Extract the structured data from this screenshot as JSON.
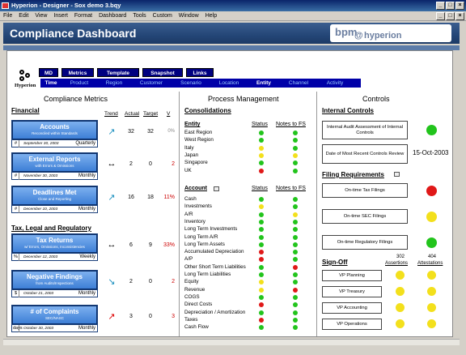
{
  "window": {
    "title": "Hyperion - Designer - Sox demo 3.bqy"
  },
  "menu": [
    "File",
    "Edit",
    "View",
    "Insert",
    "Format",
    "Dashboard",
    "Tools",
    "Custom",
    "Window",
    "Help"
  ],
  "header": {
    "title": "Compliance Dashboard",
    "brand_bpm": "bpm",
    "brand_at": "@",
    "brand_hyp": "hyperion"
  },
  "logo": {
    "text": "Hyperion"
  },
  "top_buttons": [
    "MD",
    "Metrics",
    "Template",
    "Snapshot",
    "Links"
  ],
  "tabs": [
    "Time",
    "Product",
    "Region",
    "Customer",
    "Scenario",
    "Location",
    "Entity",
    "Channel",
    "Activity"
  ],
  "active_tab": "Entity",
  "sections": {
    "left": "Compliance Metrics",
    "mid": "Process Management",
    "right": "Controls"
  },
  "left": {
    "financial": "Financial",
    "tax": "Tax, Legal and Regulatory",
    "cols": {
      "trend": "Trend",
      "actual": "Actual",
      "target": "Target",
      "v": "V"
    },
    "metrics": [
      {
        "name": "Accounts",
        "sub": "Reconciled within Standards",
        "sym": "#",
        "date": "September 30, 2003",
        "freq": "Quarterly",
        "trend": "↗",
        "actual": "32",
        "target": "32",
        "var": "0%",
        "trend_color": "#1a8fbf"
      },
      {
        "name": "External Reports",
        "sub": "with Errors & Omissions",
        "sym": "#",
        "date": "November 30, 2003",
        "freq": "Monthly",
        "trend": "↔",
        "actual": "2",
        "target": "0",
        "var": "2",
        "trend_color": "#000"
      },
      {
        "name": "Deadlines Met",
        "sub": "Close and Reporting",
        "sym": "#",
        "date": "December 10, 2003",
        "freq": "Monthly",
        "trend": "↗",
        "actual": "16",
        "target": "18",
        "var": "11%",
        "trend_color": "#1a8fbf"
      },
      {
        "name": "Tax Returns",
        "sub": "w/ Errors, Omissions, Inconsistencies",
        "sym": "%",
        "date": "December 12, 2003",
        "freq": "Weekly",
        "trend": "↔",
        "actual": "6",
        "target": "9",
        "var": "33%",
        "trend_color": "#000"
      },
      {
        "name": "Negative Findings",
        "sub": "from Audits/Inspections",
        "sym": "$",
        "date": "October 21, 2003",
        "freq": "Monthly",
        "trend": "↘",
        "actual": "2",
        "target": "0",
        "var": "2",
        "trend_color": "#1a8fbf"
      },
      {
        "name": "# of Complaints",
        "sub": "SEC/NASC",
        "sym": "days",
        "date": "October 30, 2003",
        "freq": "Monthly",
        "trend": "↗",
        "actual": "3",
        "target": "0",
        "var": "3",
        "trend_color": "#d00"
      }
    ]
  },
  "mid": {
    "consolidations": "Consolidations",
    "entity_head": "Entity",
    "status_head": "Status",
    "notes_head": "Notes to FS",
    "entities": [
      {
        "name": "East Region",
        "s": "g",
        "n": "g"
      },
      {
        "name": "West Region",
        "s": "g",
        "n": "g"
      },
      {
        "name": "Italy",
        "s": "y",
        "n": "g"
      },
      {
        "name": "Japan",
        "s": "y",
        "n": "y"
      },
      {
        "name": "Singapore",
        "s": "g",
        "n": "g"
      },
      {
        "name": "UK",
        "s": "r",
        "n": "g"
      }
    ],
    "account_head": "Account",
    "accounts": [
      {
        "name": "Cash",
        "s": "g",
        "n": "g"
      },
      {
        "name": "Investments",
        "s": "y",
        "n": "g"
      },
      {
        "name": "A/R",
        "s": "g",
        "n": "y"
      },
      {
        "name": "Inventory",
        "s": "g",
        "n": "g"
      },
      {
        "name": "Long Term Investments",
        "s": "g",
        "n": "g"
      },
      {
        "name": "Long Term A/R",
        "s": "g",
        "n": "g"
      },
      {
        "name": "Long Term Assets",
        "s": "g",
        "n": "g"
      },
      {
        "name": "Accumulated Depreciation",
        "s": "r",
        "n": "g"
      },
      {
        "name": "A/P",
        "s": "r",
        "n": "g"
      },
      {
        "name": "Other Short Term Liabilities",
        "s": "g",
        "n": "r"
      },
      {
        "name": "Long Term Liabilities",
        "s": "g",
        "n": "g"
      },
      {
        "name": "Equity",
        "s": "y",
        "n": "g"
      },
      {
        "name": "Revenue",
        "s": "y",
        "n": "r"
      },
      {
        "name": "COGS",
        "s": "g",
        "n": "g"
      },
      {
        "name": "Direct Costs",
        "s": "r",
        "n": "g"
      },
      {
        "name": "Depreciation / Amortization",
        "s": "g",
        "n": "g"
      },
      {
        "name": "Taxes",
        "s": "r",
        "n": "g"
      },
      {
        "name": "Cash Flow",
        "s": "g",
        "n": "g"
      }
    ]
  },
  "right": {
    "internal": "Internal Controls",
    "ia_box": "Internal Audit Assessment of Internal Controls",
    "date_box": "Date of Most Recent Controls Review",
    "date_value": "15-Oct-2003",
    "filing": "Filing Requirements",
    "filings": [
      {
        "name": "On-time Tax Filings",
        "s": "r"
      },
      {
        "name": "On-time SEC Filings",
        "s": "y"
      },
      {
        "name": "On-time Regulatory Filings",
        "s": "g"
      }
    ],
    "signoff": "Sign-Off",
    "assert_count": "302",
    "assert_label": "Assertions",
    "attest_count": "404",
    "attest_label": "Attestations",
    "signoffs": [
      {
        "name": "VP Planning",
        "a": "y",
        "b": "y"
      },
      {
        "name": "VP Treasury",
        "a": "y",
        "b": "y"
      },
      {
        "name": "VP Accounting",
        "a": "y",
        "b": "y"
      },
      {
        "name": "VP Operations",
        "a": "y",
        "b": "y"
      }
    ]
  }
}
